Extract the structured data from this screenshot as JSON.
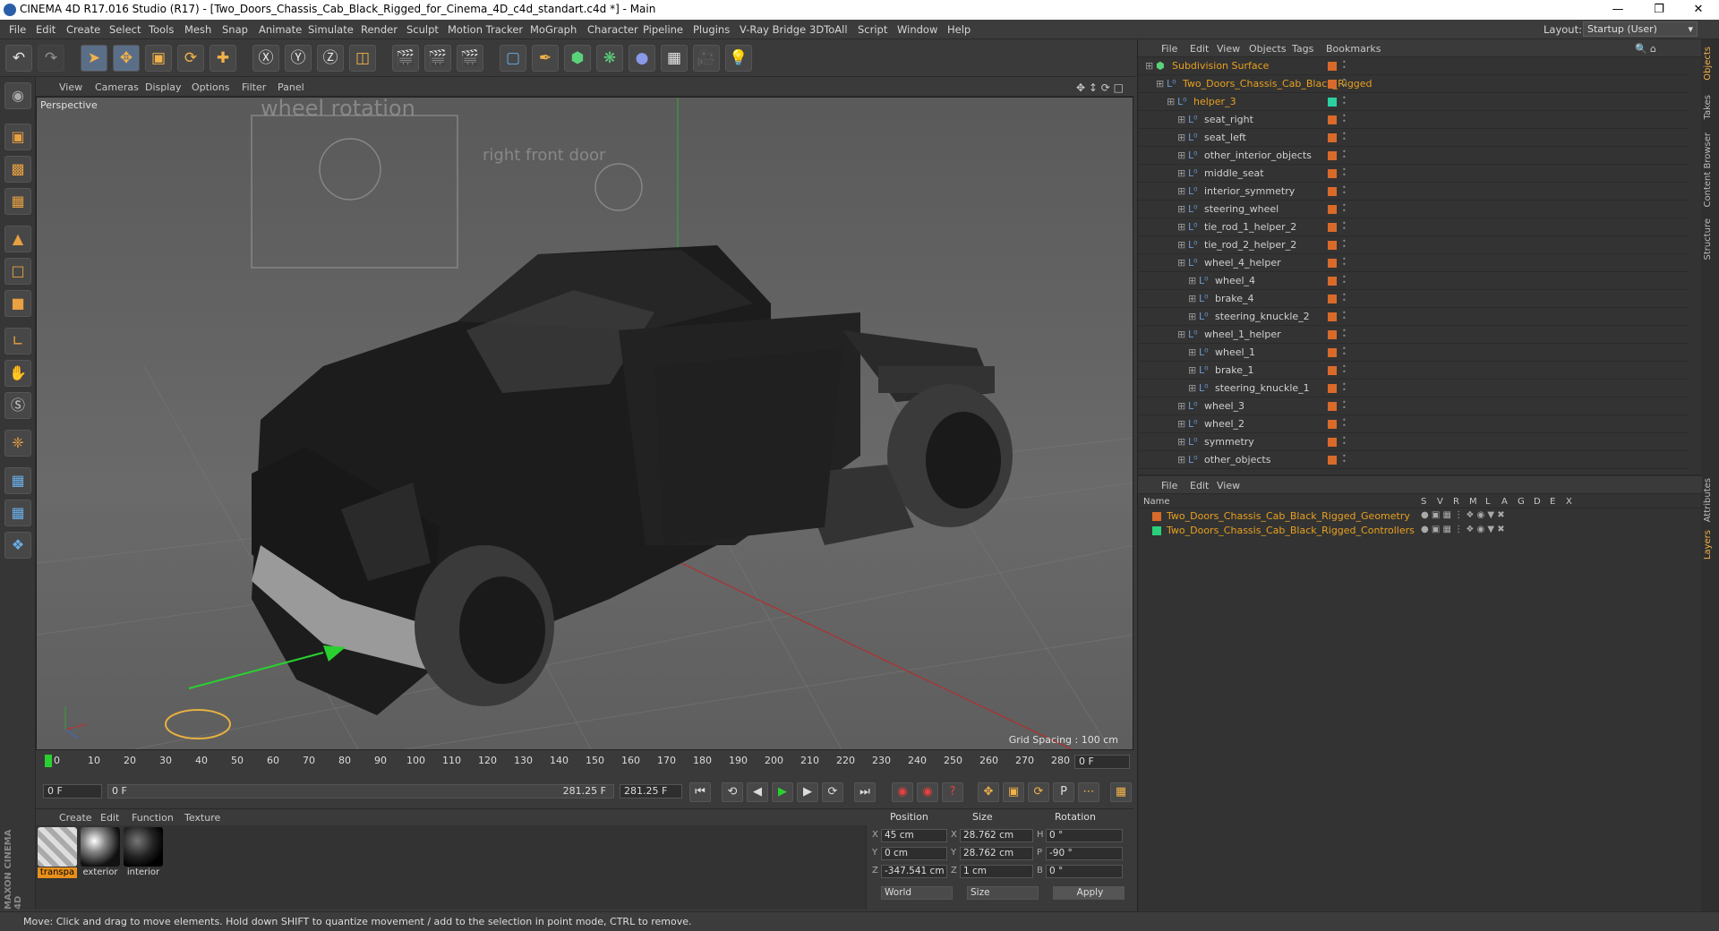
{
  "window": {
    "title": "CINEMA 4D R17.016 Studio (R17) - [Two_Doors_Chassis_Cab_Black_Rigged_for_Cinema_4D_c4d_standart.c4d *] - Main"
  },
  "menubar": {
    "items": [
      "File",
      "Edit",
      "Create",
      "Select",
      "Tools",
      "Mesh",
      "Snap",
      "Animate",
      "Simulate",
      "Render",
      "Sculpt",
      "Motion Tracker",
      "MoGraph",
      "Character",
      "Pipeline",
      "Plugins",
      "V-Ray Bridge",
      "3DToAll",
      "Script",
      "Window",
      "Help"
    ],
    "layout_label": "Layout:",
    "layout_value": "Startup (User)"
  },
  "viewport": {
    "menu": [
      "View",
      "Cameras",
      "Display",
      "Options",
      "Filter",
      "Panel"
    ],
    "label": "Perspective",
    "grid_spacing": "Grid Spacing : 100 cm",
    "scene_labels": [
      "wheel rotation",
      "right front door"
    ]
  },
  "timeline": {
    "ticks": [
      "0",
      "10",
      "20",
      "30",
      "40",
      "50",
      "60",
      "70",
      "80",
      "90",
      "100",
      "110",
      "120",
      "130",
      "140",
      "150",
      "160",
      "170",
      "180",
      "190",
      "200",
      "210",
      "220",
      "230",
      "240",
      "250",
      "260",
      "270",
      "280"
    ],
    "end_field": "0 F"
  },
  "transport": {
    "start": "0 F",
    "slider_start": "0 F",
    "slider_end": "281.25 F",
    "end": "281.25 F"
  },
  "materials": {
    "menu": [
      "Create",
      "Edit",
      "Function",
      "Texture"
    ],
    "items": [
      {
        "label": "transpa"
      },
      {
        "label": "exterior"
      },
      {
        "label": "interior"
      }
    ]
  },
  "coords": {
    "headers": [
      "Position",
      "Size",
      "Rotation"
    ],
    "pos": {
      "x": "45 cm",
      "y": "0 cm",
      "z": "-347.541 cm"
    },
    "size": {
      "x": "28.762 cm",
      "y": "28.762 cm",
      "z": "1 cm"
    },
    "rot": {
      "h": "0 °",
      "p": "-90 °",
      "b": "0 °"
    },
    "axis_labels": {
      "x": "X",
      "y": "Y",
      "z": "Z",
      "h": "H",
      "p": "P",
      "b": "B"
    },
    "world": "World",
    "size_mode": "Size",
    "apply": "Apply"
  },
  "status": {
    "text": "Move: Click and drag to move elements. Hold down SHIFT to quantize movement / add to the selection in point mode, CTRL to remove."
  },
  "objects": {
    "menu": [
      "File",
      "Edit",
      "View",
      "Objects",
      "Tags",
      "Bookmarks"
    ],
    "rows": [
      {
        "name": "Subdivision Surface",
        "indent": 0,
        "color": "#e8a020"
      },
      {
        "name": "Two_Doors_Chassis_Cab_Black_Rigged",
        "indent": 1,
        "color": "#e8a020"
      },
      {
        "name": "helper_3",
        "indent": 2,
        "color": "#e8a020"
      },
      {
        "name": "seat_right",
        "indent": 3,
        "color": "#d0d0d0"
      },
      {
        "name": "seat_left",
        "indent": 3,
        "color": "#d0d0d0"
      },
      {
        "name": "other_interior_objects",
        "indent": 3,
        "color": "#d0d0d0"
      },
      {
        "name": "middle_seat",
        "indent": 3,
        "color": "#d0d0d0"
      },
      {
        "name": "interior_symmetry",
        "indent": 3,
        "color": "#d0d0d0"
      },
      {
        "name": "steering_wheel",
        "indent": 3,
        "color": "#d0d0d0"
      },
      {
        "name": "tie_rod_1_helper_2",
        "indent": 3,
        "color": "#d0d0d0"
      },
      {
        "name": "tie_rod_2_helper_2",
        "indent": 3,
        "color": "#d0d0d0"
      },
      {
        "name": "wheel_4_helper",
        "indent": 3,
        "color": "#d0d0d0"
      },
      {
        "name": "wheel_4",
        "indent": 4,
        "color": "#d0d0d0"
      },
      {
        "name": "brake_4",
        "indent": 4,
        "color": "#d0d0d0"
      },
      {
        "name": "steering_knuckle_2",
        "indent": 4,
        "color": "#d0d0d0"
      },
      {
        "name": "wheel_1_helper",
        "indent": 3,
        "color": "#d0d0d0"
      },
      {
        "name": "wheel_1",
        "indent": 4,
        "color": "#d0d0d0"
      },
      {
        "name": "brake_1",
        "indent": 4,
        "color": "#d0d0d0"
      },
      {
        "name": "steering_knuckle_1",
        "indent": 4,
        "color": "#d0d0d0"
      },
      {
        "name": "wheel_3",
        "indent": 3,
        "color": "#d0d0d0"
      },
      {
        "name": "wheel_2",
        "indent": 3,
        "color": "#d0d0d0"
      },
      {
        "name": "symmetry",
        "indent": 3,
        "color": "#d0d0d0"
      },
      {
        "name": "other_objects",
        "indent": 3,
        "color": "#d0d0d0"
      }
    ]
  },
  "layers": {
    "menu": [
      "File",
      "Edit",
      "View"
    ],
    "headers": {
      "name": "Name",
      "cols": [
        "S",
        "V",
        "R",
        "M",
        "L",
        "A",
        "G",
        "D",
        "E",
        "X"
      ]
    },
    "rows": [
      {
        "name": "Two_Doors_Chassis_Cab_Black_Rigged_Geometry",
        "color": "#d86a2a"
      },
      {
        "name": "Two_Doors_Chassis_Cab_Black_Rigged_Controllers",
        "color": "#2ad07a"
      }
    ]
  },
  "sidetabs": [
    "Objects",
    "Takes",
    "Content Browser",
    "Structure",
    "Attributes",
    "Layers"
  ],
  "logo": "MAXON CINEMA 4D"
}
